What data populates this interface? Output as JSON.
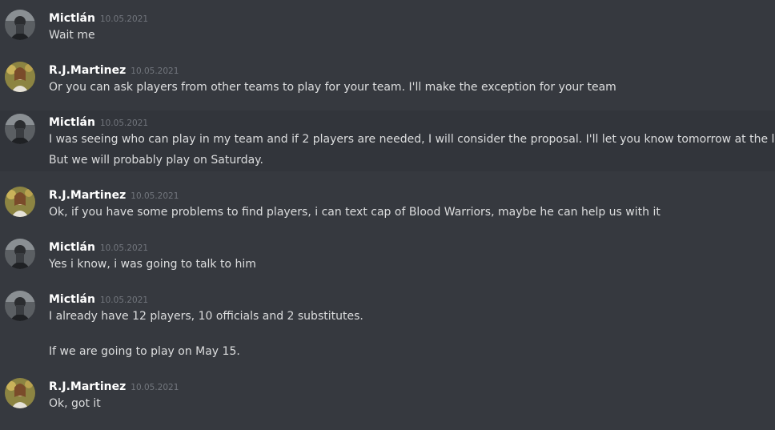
{
  "users": {
    "mictlan": "Mictlán",
    "martinez": "R.J.Martinez"
  },
  "messages": [
    {
      "author": "Mictlán",
      "timestamp": "10.05.2021",
      "lines": [
        "Wait me"
      ]
    },
    {
      "author": "R.J.Martinez",
      "timestamp": "10.05.2021",
      "lines": [
        "Or you can ask players from other teams to play for your team. I'll make the exception for your team"
      ]
    },
    {
      "author": "Mictlán",
      "timestamp": "10.05.2021",
      "lines": [
        "I was seeing who can play in my team and if 2 players are needed, I will consider the proposal. I'll let you know tomorrow at the latest.",
        "But we will probably play on Saturday."
      ]
    },
    {
      "author": "R.J.Martinez",
      "timestamp": "10.05.2021",
      "lines": [
        "Ok, if you have some problems to find players, i can text cap of Blood Warriors, maybe he can help us with it"
      ]
    },
    {
      "author": "Mictlán",
      "timestamp": "10.05.2021",
      "lines": [
        "Yes i know, i was going to talk to him"
      ]
    },
    {
      "author": "Mictlán",
      "timestamp": "10.05.2021",
      "lines": [
        "I already have 12 players, 10 officials and 2 substitutes.",
        "If we are going to play on May 15."
      ]
    },
    {
      "author": "R.J.Martinez",
      "timestamp": "10.05.2021",
      "lines": [
        "Ok, got it"
      ]
    }
  ],
  "colors": {
    "background": "#36393f",
    "username": "#ffffff",
    "text": "#dcddde",
    "timestamp": "#72767d"
  }
}
